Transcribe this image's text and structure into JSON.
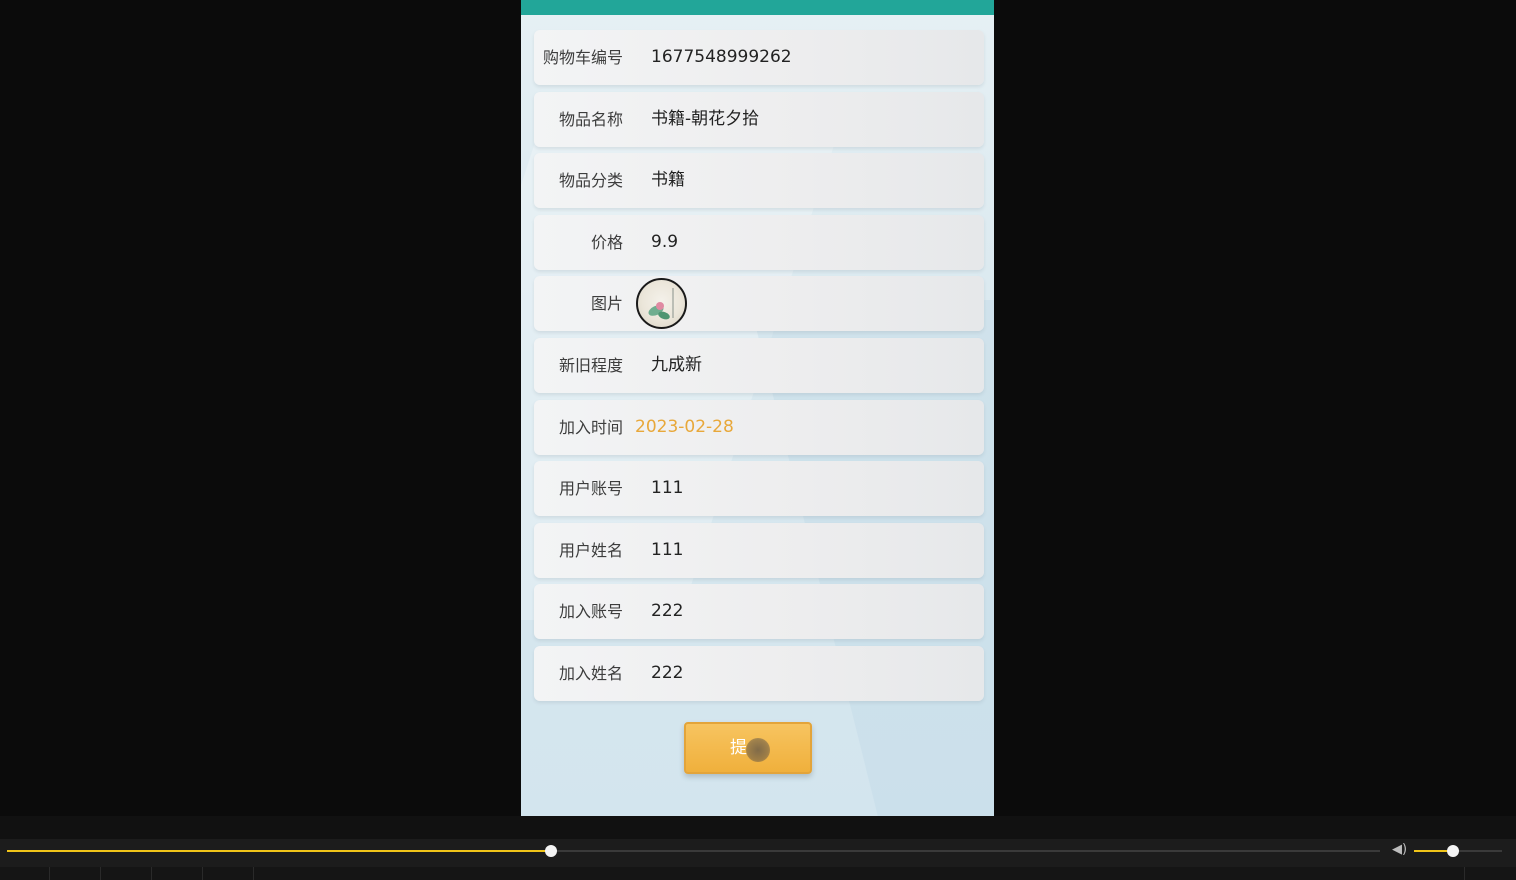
{
  "form": {
    "rows": [
      {
        "label": "购物车编号",
        "value": "1677548999262"
      },
      {
        "label": "物品名称",
        "value": "书籍-朝花夕拾"
      },
      {
        "label": "物品分类",
        "value": "书籍"
      },
      {
        "label": "价格",
        "value": "9.9"
      },
      {
        "label": "图片",
        "value": ""
      },
      {
        "label": "新旧程度",
        "value": "九成新"
      },
      {
        "label": "加入时间",
        "value": "2023-02-28"
      },
      {
        "label": "用户账号",
        "value": "111"
      },
      {
        "label": "用户姓名",
        "value": "111"
      },
      {
        "label": "加入账号",
        "value": "222"
      },
      {
        "label": "加入姓名",
        "value": "222"
      }
    ],
    "submit_label": "提"
  },
  "colors": {
    "header": "#22a699",
    "accent_button": "#f0b03c",
    "date_text": "#e8a83a",
    "progress": "#f0c419"
  },
  "player": {
    "progress_fraction": 0.396,
    "volume_fraction": 0.44,
    "volume_icon": "speaker-icon"
  }
}
